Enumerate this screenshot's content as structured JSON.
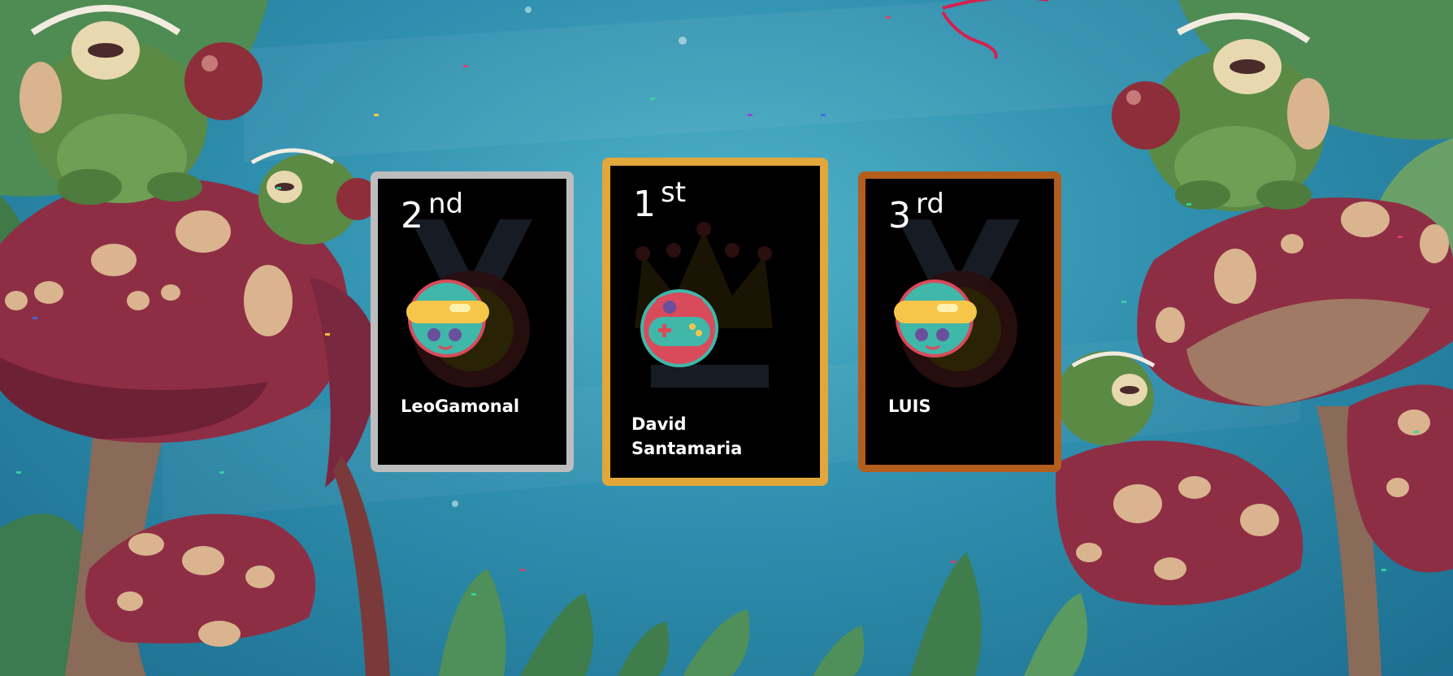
{
  "podium": {
    "second": {
      "place_number": "2",
      "place_suffix": "nd",
      "player_name": "LeoGamonal",
      "avatar_icon": "goggles-face-avatar-icon",
      "border_color": "#bdbdbd"
    },
    "first": {
      "place_number": "1",
      "place_suffix": "st",
      "player_name": "David Santamaria",
      "avatar_icon": "gamepad-avatar-icon",
      "border_color": "#e2a63a"
    },
    "third": {
      "place_number": "3",
      "place_suffix": "rd",
      "player_name": "LUIS",
      "avatar_icon": "goggles-face-avatar-icon",
      "border_color": "#b35e1c"
    }
  },
  "colors": {
    "card_background": "#000000",
    "text": "#ffffff",
    "sky": "#2f8fae"
  }
}
